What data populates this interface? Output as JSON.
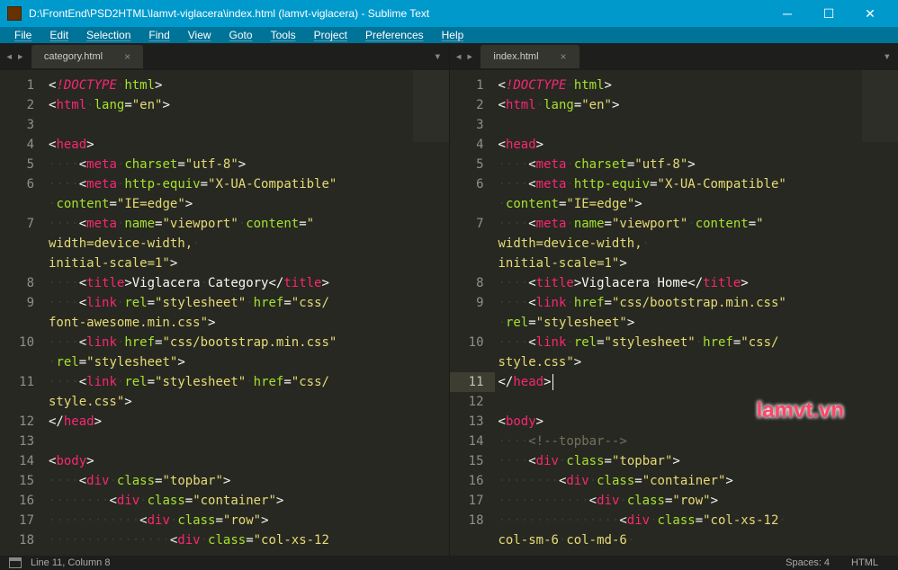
{
  "titlebar": {
    "title": "D:\\FrontEnd\\PSD2HTML\\lamvt-viglacera\\index.html (lamvt-viglacera) - Sublime Text"
  },
  "menubar": {
    "items": [
      "File",
      "Edit",
      "Selection",
      "Find",
      "View",
      "Goto",
      "Tools",
      "Project",
      "Preferences",
      "Help"
    ]
  },
  "panes": {
    "left": {
      "tab": {
        "label": "category.html"
      },
      "lines": [
        "1",
        "2",
        "3",
        "4",
        "5",
        "6",
        "7",
        "8",
        "9",
        "10",
        "11",
        "12",
        "13",
        "14",
        "15",
        "16",
        "17",
        "18"
      ]
    },
    "right": {
      "tab": {
        "label": "index.html"
      },
      "lines": [
        "1",
        "2",
        "3",
        "4",
        "5",
        "6",
        "7",
        "8",
        "9",
        "10",
        "11",
        "12",
        "13",
        "14",
        "15",
        "16",
        "17",
        "18"
      ],
      "active_line_index": 10
    }
  },
  "statusbar": {
    "position": "Line 11, Column 8",
    "spaces": "Spaces: 4",
    "syntax": "HTML"
  },
  "watermark": "lamvt.vn"
}
